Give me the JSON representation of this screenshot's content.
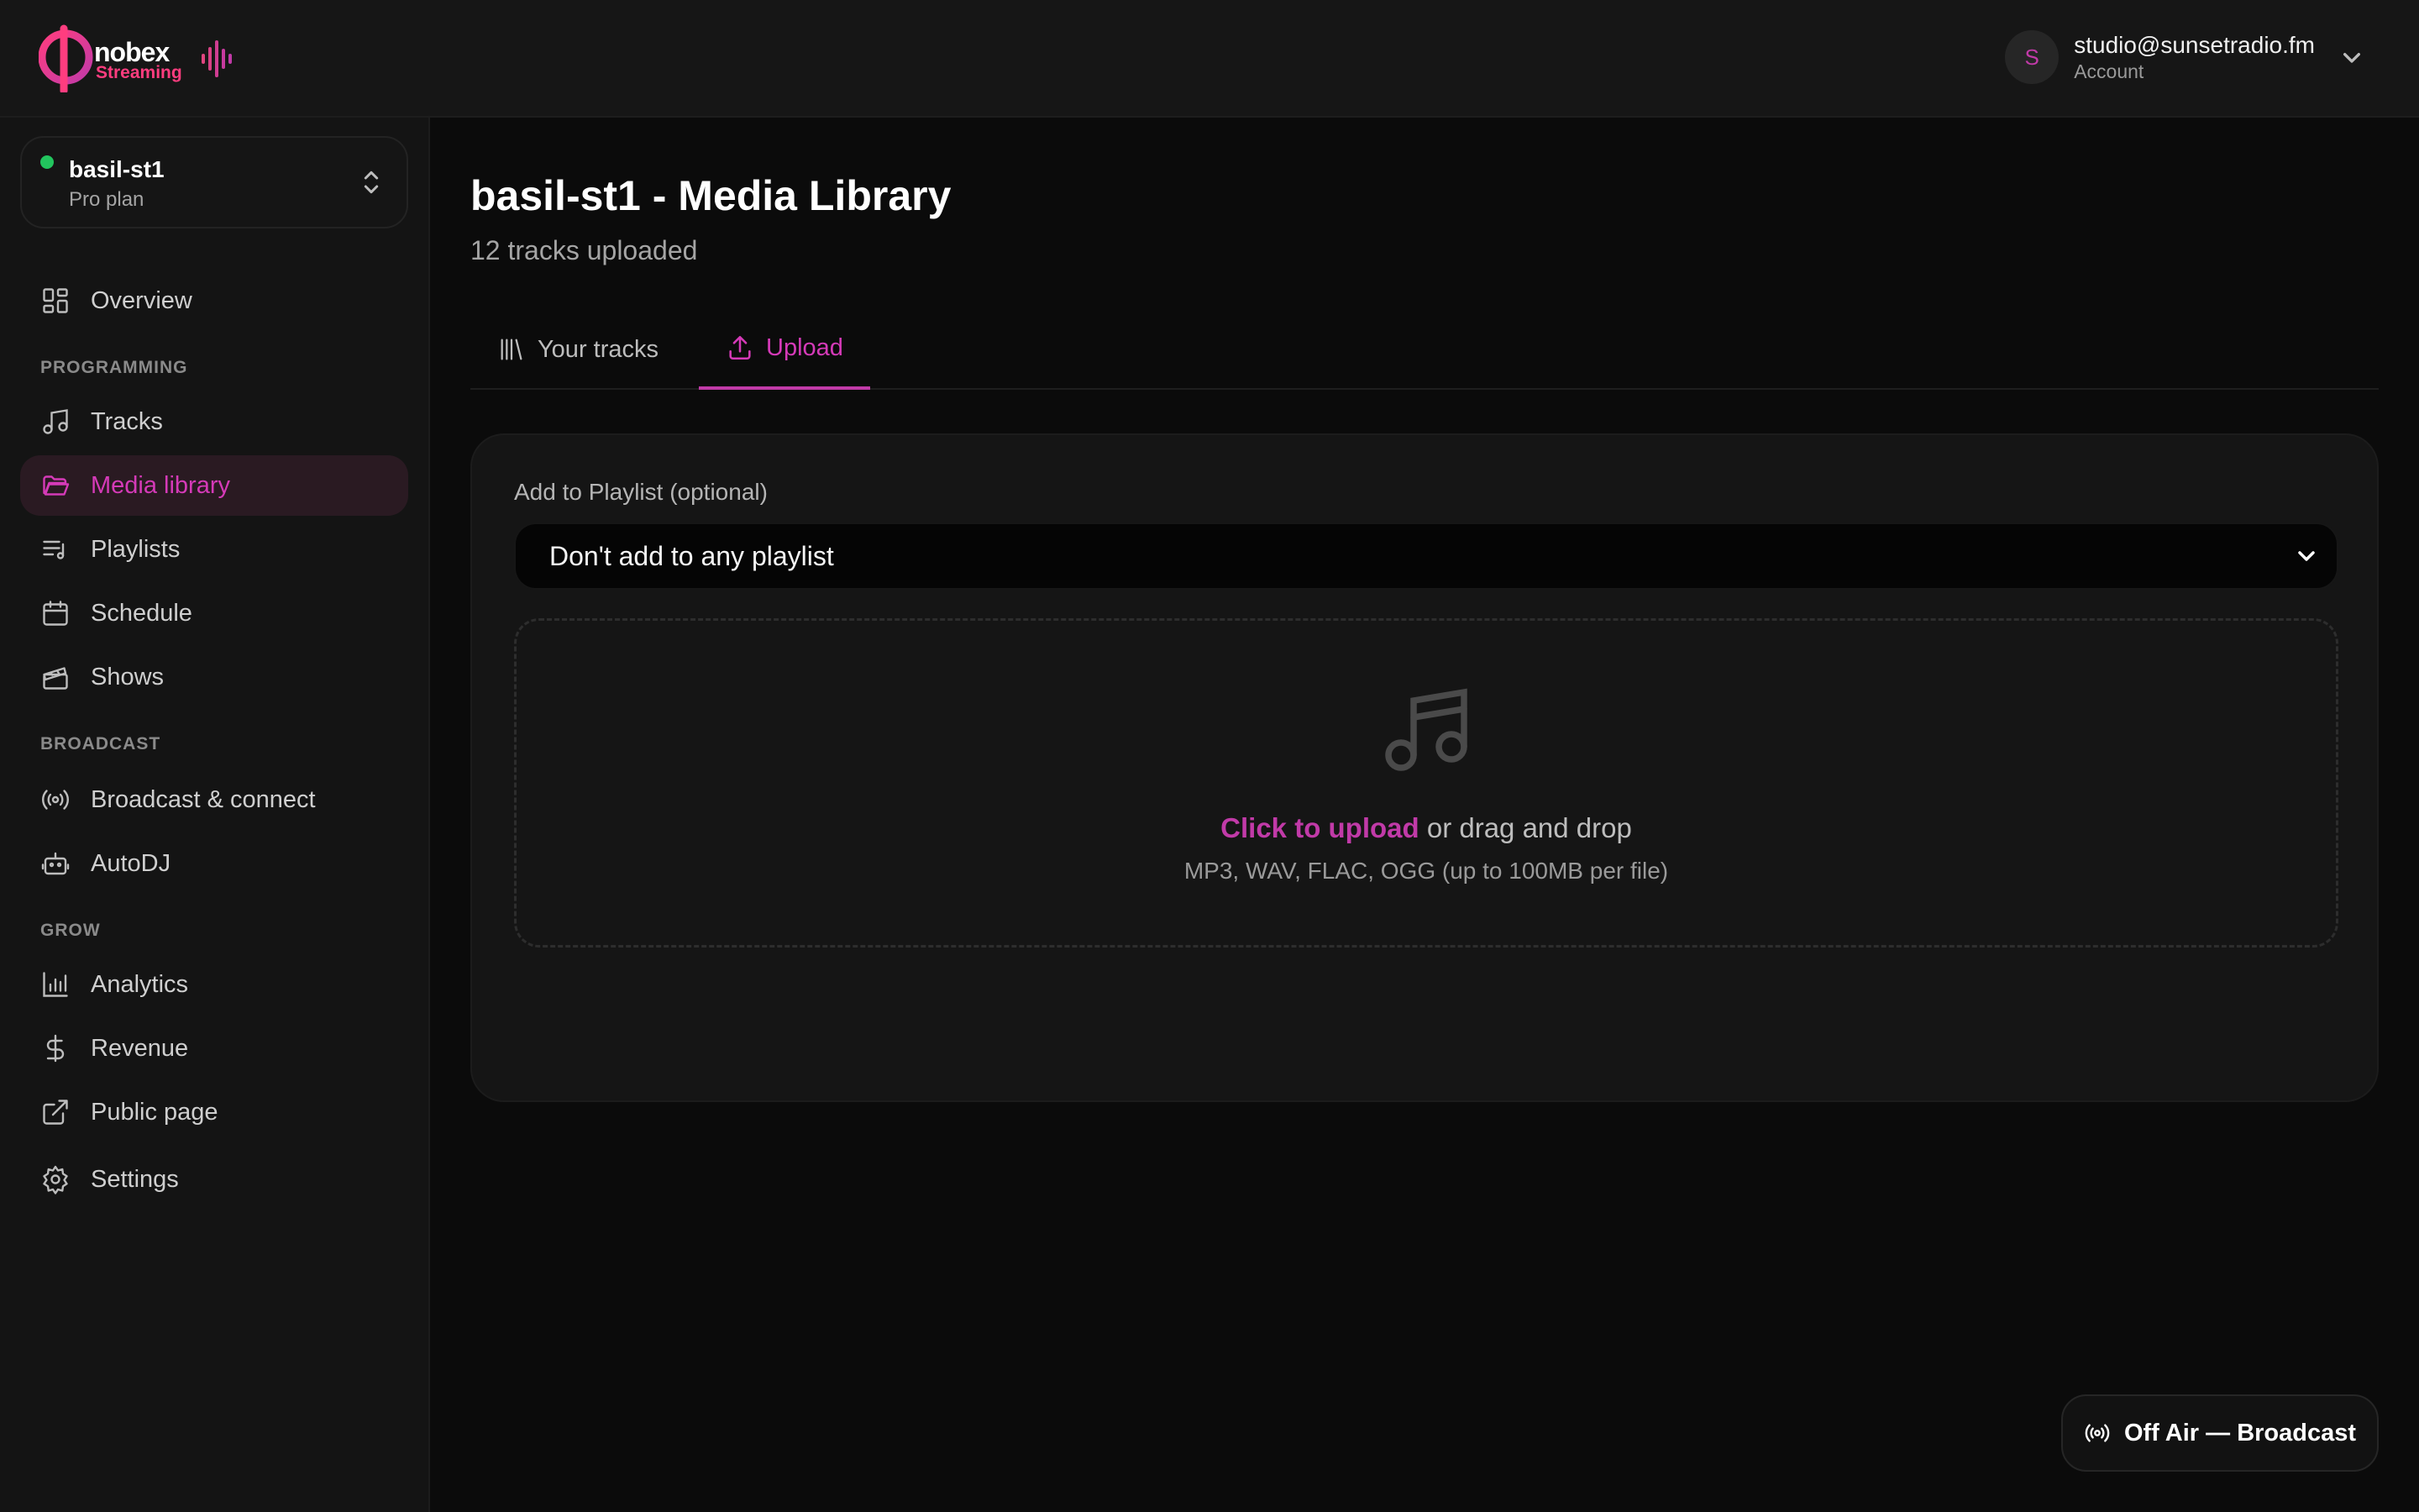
{
  "brand": {
    "name": "nobex",
    "sub": "Streaming",
    "accent": "#c13aa8",
    "gradient_start": "#ff3d7f",
    "gradient_end": "#c13aa8"
  },
  "account": {
    "initial": "S",
    "email": "studio@sunsetradio.fm",
    "label": "Account"
  },
  "station": {
    "name": "basil-st1",
    "plan": "Pro plan",
    "status_color": "#22c55e"
  },
  "sidebar": {
    "overview": "Overview",
    "sections": {
      "programming": "PROGRAMMING",
      "broadcast": "BROADCAST",
      "grow": "GROW"
    },
    "items": {
      "tracks": "Tracks",
      "media_library": "Media library",
      "playlists": "Playlists",
      "schedule": "Schedule",
      "shows": "Shows",
      "broadcast_connect": "Broadcast & connect",
      "autodj": "AutoDJ",
      "analytics": "Analytics",
      "revenue": "Revenue",
      "public_page": "Public page",
      "settings": "Settings"
    },
    "active": "media_library"
  },
  "main": {
    "title": "basil-st1 - Media Library",
    "subtitle": "12 tracks uploaded",
    "tabs": [
      {
        "label": "Your tracks",
        "icon": "library-icon",
        "active": false
      },
      {
        "label": "Upload",
        "icon": "upload-icon",
        "active": true
      }
    ]
  },
  "upload": {
    "playlist_label": "Add to Playlist (optional)",
    "playlist_selected": "Don't add to any playlist",
    "dropzone_icon": "music-note-icon",
    "click_text": "Click to upload",
    "drag_text": " or drag and drop",
    "hint": "MP3, WAV, FLAC, OGG (up to 100MB per file)"
  },
  "broadcast_button": {
    "label": "Off Air — Broadcast",
    "icon": "radio-waves-icon"
  }
}
